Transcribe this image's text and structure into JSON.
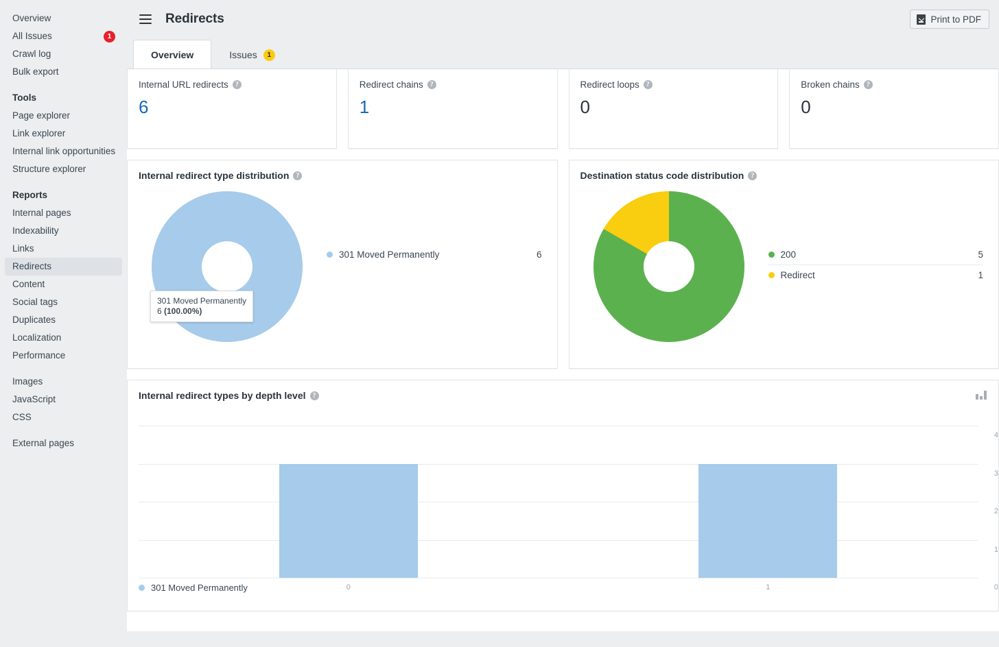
{
  "sidebar": {
    "top_items": [
      {
        "label": "Overview",
        "badge": null
      },
      {
        "label": "All Issues",
        "badge": "1"
      },
      {
        "label": "Crawl log",
        "badge": null
      },
      {
        "label": "Bulk export",
        "badge": null
      }
    ],
    "tools_title": "Tools",
    "tools_items": [
      {
        "label": "Page explorer"
      },
      {
        "label": "Link explorer"
      },
      {
        "label": "Internal link opportunities"
      },
      {
        "label": "Structure explorer"
      }
    ],
    "reports_title": "Reports",
    "reports_items": [
      {
        "label": "Internal pages"
      },
      {
        "label": "Indexability"
      },
      {
        "label": "Links"
      },
      {
        "label": "Redirects"
      },
      {
        "label": "Content"
      },
      {
        "label": "Social tags"
      },
      {
        "label": "Duplicates"
      },
      {
        "label": "Localization"
      },
      {
        "label": "Performance"
      }
    ],
    "resource_items": [
      {
        "label": "Images"
      },
      {
        "label": "JavaScript"
      },
      {
        "label": "CSS"
      }
    ],
    "external_items": [
      {
        "label": "External pages"
      }
    ],
    "active_item": "Redirects"
  },
  "header": {
    "title": "Redirects",
    "menu_icon": "hamburger-icon",
    "print_button": "Print to PDF",
    "print_icon": "file-download-icon"
  },
  "tabs": [
    {
      "label": "Overview",
      "badge": null,
      "active": true
    },
    {
      "label": "Issues",
      "badge": "1",
      "active": false
    }
  ],
  "stat_cards": [
    {
      "label": "Internal URL redirects",
      "value": "6",
      "is_link": true
    },
    {
      "label": "Redirect chains",
      "value": "1",
      "is_link": true
    },
    {
      "label": "Redirect loops",
      "value": "0",
      "is_link": false
    },
    {
      "label": "Broken chains",
      "value": "0",
      "is_link": false
    }
  ],
  "help_glyph": "?",
  "panels": {
    "redirect_type": {
      "title": "Internal redirect type distribution"
    },
    "status_code": {
      "title": "Destination status code distribution"
    },
    "depth_level": {
      "title": "Internal redirect types by depth level"
    }
  },
  "tooltip": {
    "title": "301 Moved Permanently",
    "count": "6 ",
    "percent": "(100.00%)"
  },
  "colors": {
    "blue": "#a6cbeb",
    "green": "#5cb14f",
    "yellow": "#f9cd10",
    "link": "#1769b5",
    "badge_red": "#e8202a",
    "badge_yellow": "#fbcb13"
  },
  "chart_data": [
    {
      "type": "pie",
      "title": "Internal redirect type distribution",
      "labels": [
        "301 Moved Permanently"
      ],
      "values": [
        6
      ],
      "percents": [
        "100.00%"
      ],
      "colors": [
        "#a6cbeb"
      ],
      "legend_position": "right",
      "donut": true
    },
    {
      "type": "pie",
      "title": "Destination status code distribution",
      "labels": [
        "200",
        "Redirect"
      ],
      "values": [
        5,
        1
      ],
      "percents": [
        "83.33%",
        "16.67%"
      ],
      "colors": [
        "#5cb14f",
        "#f9cd10"
      ],
      "legend_position": "right",
      "donut": true
    },
    {
      "type": "bar",
      "title": "Internal redirect types by depth level",
      "categories": [
        "0",
        "1"
      ],
      "series": [
        {
          "name": "301 Moved Permanently",
          "values": [
            3,
            3
          ],
          "color": "#a6cbeb"
        }
      ],
      "xlabel": "",
      "ylabel": "",
      "ylim": [
        0,
        4
      ],
      "yticks": [
        "0",
        "1",
        "2",
        "3",
        "4"
      ],
      "yaxis_position": "right",
      "grid": true,
      "legend_position": "bottom-left"
    }
  ]
}
